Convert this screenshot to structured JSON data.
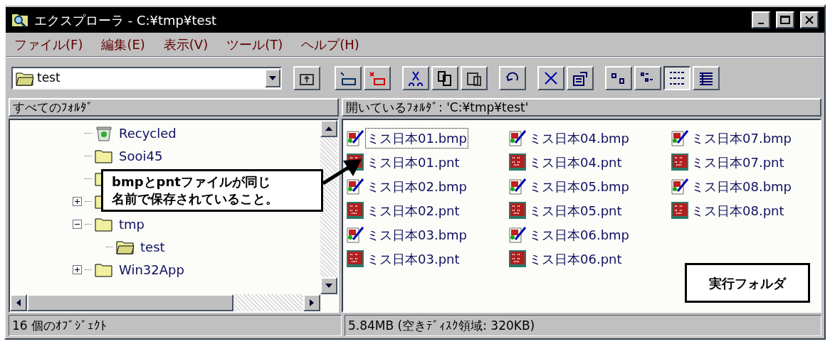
{
  "window": {
    "title": "エクスプローラ - C:¥tmp¥test"
  },
  "menu": [
    "ファイル(F)",
    "編集(E)",
    "表示(V)",
    "ツール(T)",
    "ヘルプ(H)"
  ],
  "address": {
    "value": "test"
  },
  "views": [
    {
      "kind": "large",
      "selected": false
    },
    {
      "kind": "small",
      "selected": false
    },
    {
      "kind": "list",
      "selected": true
    },
    {
      "kind": "details",
      "selected": false
    }
  ],
  "tree_header": "すべてのﾌｫﾙﾀﾞ",
  "content_header": "開いているﾌｫﾙﾀﾞ: 'C:¥tmp¥test'",
  "tree": [
    {
      "label": "Recycled",
      "kind": "recycle"
    },
    {
      "label": "Sooi45",
      "kind": "folder"
    },
    {
      "kind": "folder"
    },
    {
      "kind": "folder",
      "expanded": false
    },
    {
      "label": "tmp",
      "kind": "folder",
      "expanded": true,
      "children": [
        {
          "label": "test",
          "kind": "open"
        }
      ]
    },
    {
      "label": "Win32App",
      "kind": "folder",
      "expanded": false
    }
  ],
  "files": [
    {
      "name": "ミス日本01.bmp",
      "kind": "bmp",
      "selected": true
    },
    {
      "name": "ミス日本01.pnt",
      "kind": "pnt",
      "selected": false
    },
    {
      "name": "ミス日本02.bmp",
      "kind": "bmp",
      "selected": false
    },
    {
      "name": "ミス日本02.pnt",
      "kind": "pnt",
      "selected": false
    },
    {
      "name": "ミス日本03.bmp",
      "kind": "bmp",
      "selected": false
    },
    {
      "name": "ミス日本03.pnt",
      "kind": "pnt",
      "selected": false
    },
    {
      "name": "ミス日本04.bmp",
      "kind": "bmp",
      "selected": false
    },
    {
      "name": "ミス日本04.pnt",
      "kind": "pnt",
      "selected": false
    },
    {
      "name": "ミス日本05.bmp",
      "kind": "bmp",
      "selected": false
    },
    {
      "name": "ミス日本05.pnt",
      "kind": "pnt",
      "selected": false
    },
    {
      "name": "ミス日本06.bmp",
      "kind": "bmp",
      "selected": false
    },
    {
      "name": "ミス日本06.pnt",
      "kind": "pnt",
      "selected": false
    },
    {
      "name": "ミス日本07.bmp",
      "kind": "bmp",
      "selected": false
    },
    {
      "name": "ミス日本07.pnt",
      "kind": "pnt",
      "selected": false
    },
    {
      "name": "ミス日本08.bmp",
      "kind": "bmp",
      "selected": false
    },
    {
      "name": "ミス日本08.pnt",
      "kind": "pnt",
      "selected": false
    }
  ],
  "callouts": {
    "note": [
      "bmpとpntファイルが同じ",
      "名前で保存されていること。"
    ],
    "folder": "実行フォルダ"
  },
  "status_bar": [
    "16 個のｵﾌﾞｼﾞｪｸﾄ",
    "5.84MB (空きﾃﾞｨｽｸ領域: 320KB)"
  ]
}
